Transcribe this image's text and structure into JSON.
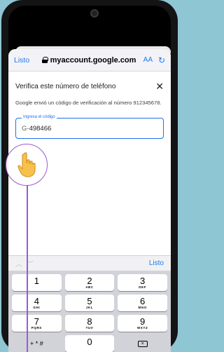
{
  "browser": {
    "done_label": "Listo",
    "url": "myaccount.google.com",
    "text_size_label": "AA",
    "reload_icon": "reload-icon"
  },
  "dialog": {
    "title": "Verifica este número de teléfono",
    "description": "Google envió un código de verificación al número 912345678.",
    "field_label": "Ingresa el código",
    "code_prefix": "G-",
    "code_value": "498466"
  },
  "accessory_bar": {
    "done_label": "Listo"
  },
  "keypad": {
    "keys": [
      {
        "num": "1",
        "letters": ""
      },
      {
        "num": "2",
        "letters": "ABC"
      },
      {
        "num": "3",
        "letters": "DEF"
      },
      {
        "num": "4",
        "letters": "GHI"
      },
      {
        "num": "5",
        "letters": "JKL"
      },
      {
        "num": "6",
        "letters": "MNO"
      },
      {
        "num": "7",
        "letters": "PQRS"
      },
      {
        "num": "8",
        "letters": "TUV"
      },
      {
        "num": "9",
        "letters": "WXYZ"
      }
    ],
    "symbols_label": "+ * #",
    "zero": "0"
  },
  "colors": {
    "accent": "#1a73e8",
    "ios_blue": "#1d7bf2",
    "pointer": "#9b59d6",
    "background": "#8fc6d4"
  }
}
